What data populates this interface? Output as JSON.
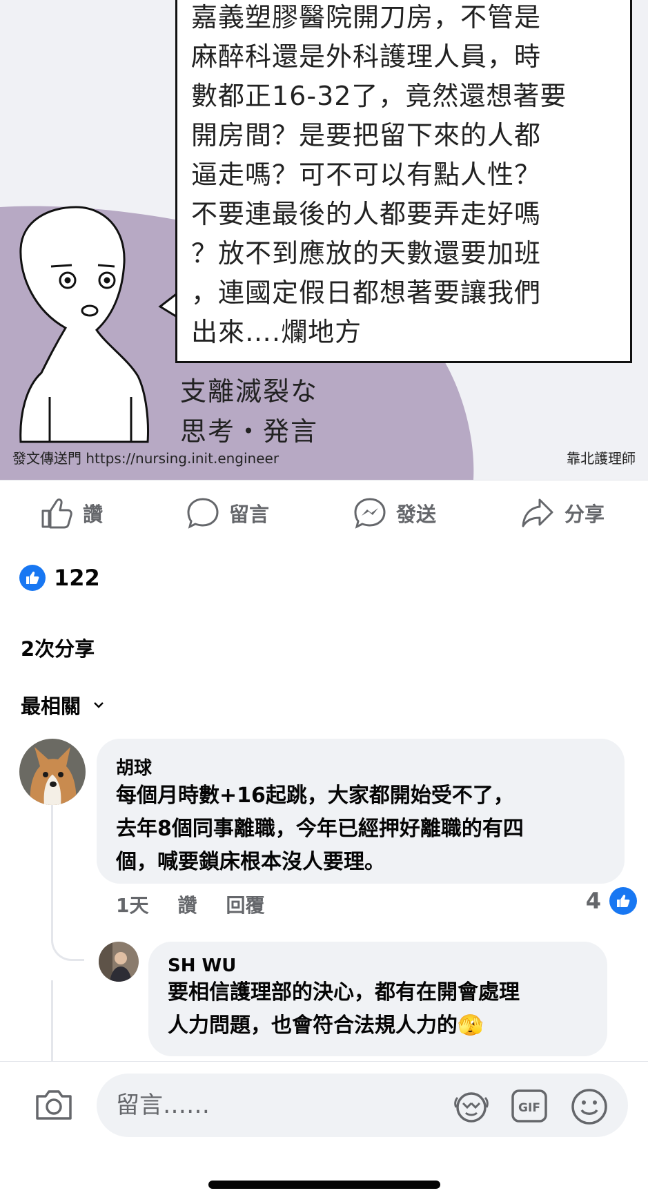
{
  "post": {
    "bubble_lines": [
      "嘉義塑膠醫院開刀房，不管是",
      "麻醉科還是外科護理人員，時",
      "數都正16-32了，竟然還想著要",
      "開房間？是要把留下來的人都",
      "逼走嗎？可不可以有點人性？",
      "不要連最後的人都要弄走好嗎",
      "？放不到應放的天數還要加班",
      "，連國定假日都想著要讓我們",
      "出來….爛地方"
    ],
    "caption_lines": [
      "支離滅裂な",
      "思考・発言"
    ],
    "watermark_left": "發文傳送門 https://nursing.init.engineer",
    "watermark_right": "靠北護理師"
  },
  "actions": {
    "like": "讚",
    "comment": "留言",
    "send": "發送",
    "share": "分享"
  },
  "reactions": {
    "count": "122"
  },
  "shares": "2次分享",
  "sort": "最相關",
  "comments": [
    {
      "author": "胡球",
      "lines": [
        "每個月時數+16起跳，大家都開始受不了，",
        "去年8個同事離職，今年已經押好離職的有四",
        "個，喊要鎖床根本沒人要理。"
      ],
      "time": "1天",
      "like_label": "讚",
      "reply_label": "回覆",
      "likes": "4"
    },
    {
      "author": "SH WU",
      "lines": [
        "要相信護理部的決心，都有在開會處理",
        "人力問題，也會符合法規人力的"
      ],
      "emoji": "🫣"
    }
  ],
  "composer": {
    "placeholder": "留言……"
  },
  "colors": {
    "accent": "#1877f2",
    "bubble": "#f0f2f5",
    "purple": "#b7a9c4",
    "muted": "#65676b"
  }
}
